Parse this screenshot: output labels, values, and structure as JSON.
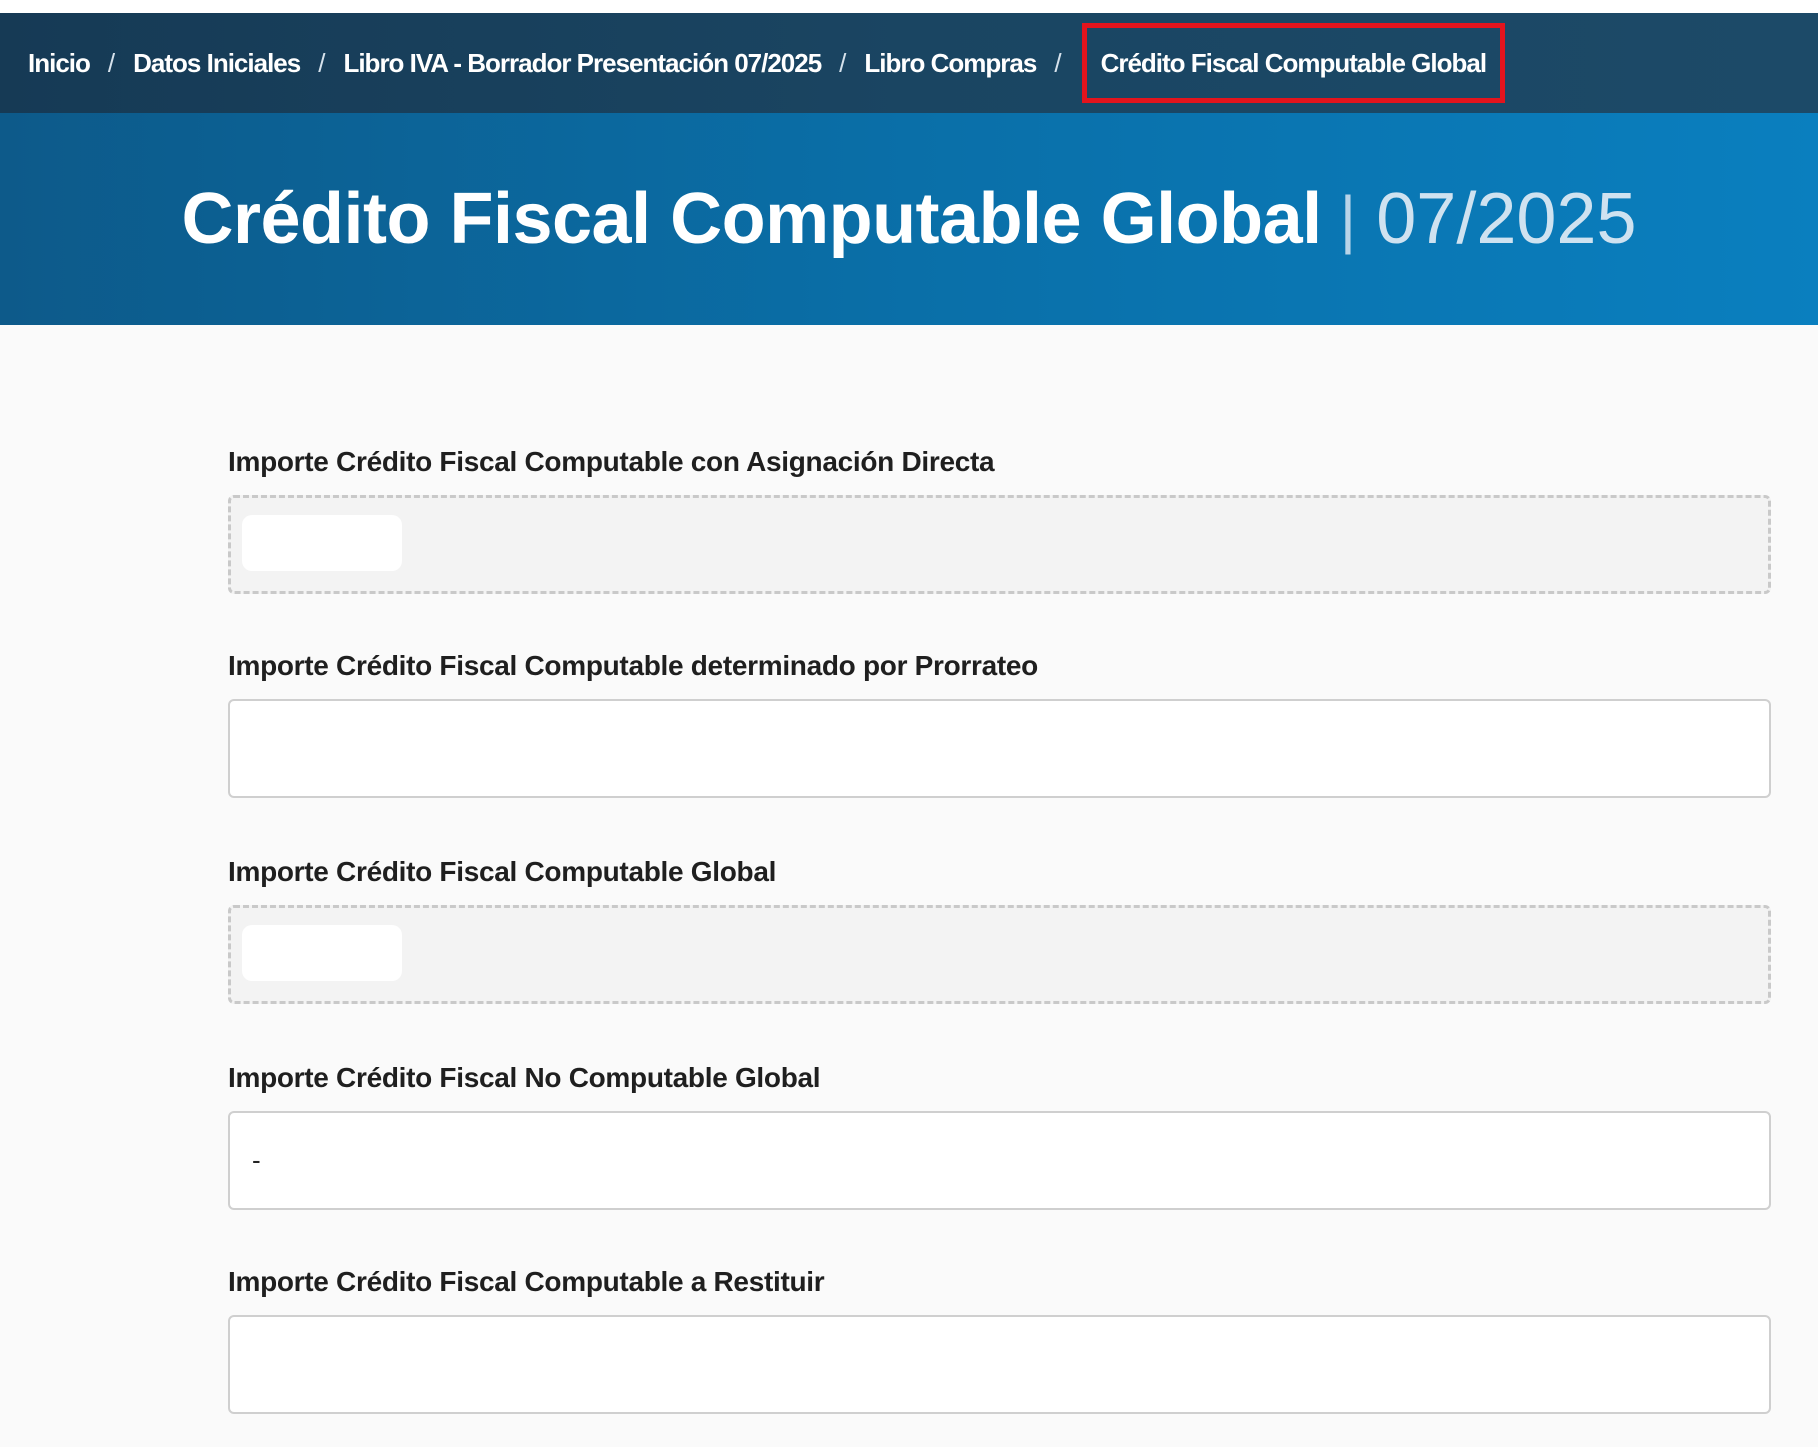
{
  "breadcrumb": {
    "items": [
      {
        "label": "Inicio"
      },
      {
        "label": "Datos Iniciales"
      },
      {
        "label": "Libro IVA - Borrador Presentación 07/2025"
      },
      {
        "label": "Libro Compras"
      },
      {
        "label": "Crédito Fiscal Computable Global"
      }
    ],
    "separator": "/"
  },
  "header": {
    "title": "Crédito Fiscal Computable Global",
    "separator": "|",
    "period": "07/2025"
  },
  "form": {
    "fields": [
      {
        "label": "Importe Crédito Fiscal Computable con Asignación Directa",
        "value": "",
        "readonly": true
      },
      {
        "label": "Importe Crédito Fiscal Computable determinado por Prorrateo",
        "value": "",
        "readonly": false
      },
      {
        "label": "Importe Crédito Fiscal Computable Global",
        "value": "",
        "readonly": true
      },
      {
        "label": "Importe Crédito Fiscal No Computable Global",
        "value": "-",
        "readonly": false
      },
      {
        "label": "Importe Crédito Fiscal Computable a Restituir",
        "value": "",
        "readonly": false
      }
    ]
  },
  "colors": {
    "breadcrumb_bg": "#1a4562",
    "hero_bg": "#0a6fa8",
    "highlight_border": "#e3141d",
    "page_bg": "#fafafa"
  }
}
